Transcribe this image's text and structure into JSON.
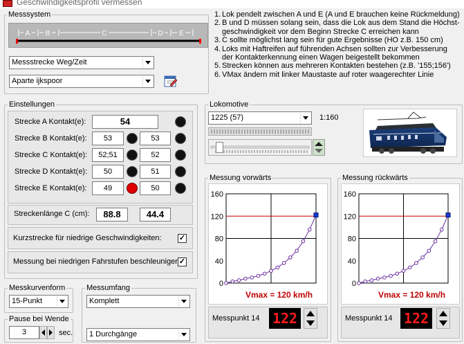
{
  "window": {
    "title": "Geschwindigkeitsprofil vermessen"
  },
  "messsystem": {
    "label": "Messsystem",
    "track_segments": [
      "A",
      "B",
      "C",
      "D",
      "E"
    ],
    "mode_select": "Messstrecke Weg/Zeit",
    "track_select": "Aparte ijkspoor",
    "notes": [
      {
        "num": "1.",
        "text": "Lok pendelt zwischen A und E (A und E brauchen keine Rückmeldung)"
      },
      {
        "num": "2.",
        "text": "B und D müssen solang sein, dass die Lok aus dem Stand die Höchst-"
      },
      {
        "num": "",
        "text": "geschwindigkeit vor dem Beginn Strecke C erreichen kann"
      },
      {
        "num": "3.",
        "text": "C sollte möglichst lang sein für gute Ergebnisse (HO z.B. 150 cm)"
      },
      {
        "num": "4.",
        "text": "Loks mit Haftreifen auf führenden Achsen sollten zur Verbesserung"
      },
      {
        "num": "",
        "text": "der Kontakterkennung einen Wagen beigestellt bekommen"
      },
      {
        "num": "5.",
        "text": "Strecken können aus mehreren Kontakten bestehen (z.B. '155;156')"
      },
      {
        "num": "6.",
        "text": "VMax ändern mit linker Maustaste auf roter waagerechter Linie"
      }
    ]
  },
  "einstellungen": {
    "label": "Einstellungen",
    "rows": [
      {
        "label": "Strecke A Kontakt(e):",
        "a": "54",
        "b": "",
        "led1": "black",
        "led2": ""
      },
      {
        "label": "Strecke B Kontakt(e):",
        "a": "53",
        "b": "53",
        "led1": "black",
        "led2": "black"
      },
      {
        "label": "Strecke C Kontakt(e):",
        "a": "52;51",
        "b": "52",
        "led1": "black",
        "led2": "black"
      },
      {
        "label": "Strecke D Kontakt(e):",
        "a": "50",
        "b": "51",
        "led1": "black",
        "led2": "black"
      },
      {
        "label": "Strecke E Kontakt(e):",
        "a": "49",
        "b": "50",
        "led1": "red",
        "led2": "black"
      }
    ],
    "length_label": "Streckenlänge C (cm):",
    "length_a": "88.8",
    "length_b": "44.4",
    "short_label": "Kurzstrecke für niedrige Geschwindigkeiten:",
    "short_checked": "✓",
    "accel_label": "Messung bei niedrigen Fahrstufen beschleunigen:",
    "accel_checked": "✓"
  },
  "messkurvenform": {
    "label": "Messkurvenform",
    "value": "15-Punkt"
  },
  "messumfang": {
    "label": "Messumfang",
    "value": "Komplett",
    "durchgaenge": "1 Durchgänge"
  },
  "pause": {
    "label": "Pause bei Wende",
    "value": "3",
    "unit": "sec."
  },
  "lokomotive": {
    "label": "Lokomotive",
    "select": "1225 (57)",
    "scale": "1:160",
    "speed_level": 0.05
  },
  "messung_vor": {
    "label": "Messung vorwärts",
    "vmax": "Vmax = 120 km/h",
    "punkt_label": "Messpunkt 14",
    "punkt_value": "122"
  },
  "messung_rueck": {
    "label": "Messung rückwärts",
    "vmax": "Vmax = 120 km/h",
    "punkt_label": "Messpunkt 14",
    "punkt_value": "122"
  },
  "chart_data": [
    {
      "type": "line",
      "title": "Messung vorwärts",
      "ylim": [
        0,
        160
      ],
      "yticks": [
        0,
        40,
        80,
        120,
        160
      ],
      "vmax_line": 120,
      "grid": true,
      "x": [
        0,
        1,
        2,
        3,
        4,
        5,
        6,
        7,
        8,
        9,
        10,
        11,
        12,
        13,
        14
      ],
      "series": [
        {
          "values": [
            0,
            3,
            5,
            8,
            10,
            13,
            17,
            22,
            28,
            36,
            46,
            58,
            75,
            96,
            122
          ]
        }
      ]
    },
    {
      "type": "line",
      "title": "Messung rückwärts",
      "ylim": [
        0,
        160
      ],
      "yticks": [
        0,
        40,
        80,
        120,
        160
      ],
      "vmax_line": 120,
      "grid": true,
      "x": [
        0,
        1,
        2,
        3,
        4,
        5,
        6,
        7,
        8,
        9,
        10,
        11,
        12,
        13,
        14
      ],
      "series": [
        {
          "values": [
            0,
            3,
            5,
            8,
            10,
            13,
            17,
            22,
            28,
            36,
            46,
            58,
            75,
            96,
            122
          ]
        }
      ]
    }
  ]
}
